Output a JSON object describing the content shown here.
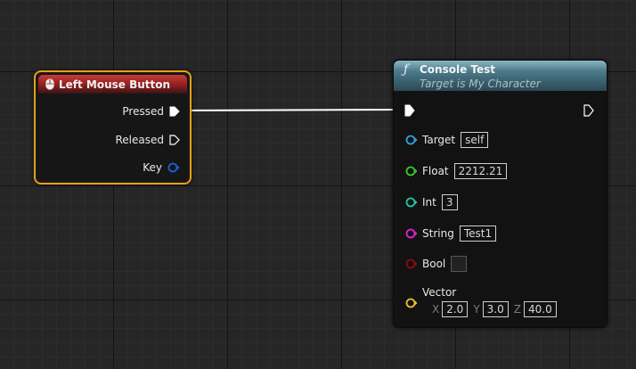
{
  "event_node": {
    "title": "Left Mouse Button",
    "pins": {
      "pressed": "Pressed",
      "released": "Released",
      "key": "Key"
    }
  },
  "function_node": {
    "title": "Console Test",
    "subtitle": "Target is My Character",
    "inputs": [
      {
        "label": "Target",
        "value": "self",
        "color": "#2f9fdd"
      },
      {
        "label": "Float",
        "value": "2212.21",
        "color": "#39c92b"
      },
      {
        "label": "Int",
        "value": "3",
        "color": "#1ec7a3"
      },
      {
        "label": "String",
        "value": "Test1",
        "color": "#e21fd7"
      },
      {
        "label": "Bool",
        "value": "",
        "color": "#8a0b0b"
      },
      {
        "label": "Vector",
        "color": "#f1be28",
        "x": "2.0",
        "y": "3.0",
        "z": "40.0"
      }
    ],
    "axis_labels": {
      "x": "X",
      "y": "Y",
      "z": "Z"
    }
  },
  "colors": {
    "event_border": "#e7a01a",
    "event_header": "#c63a3a",
    "function_header": "#5e8f9e",
    "exec_wire": "#ffffff",
    "key_pin": "#1c5fd6"
  },
  "icons": {
    "function": "ƒ",
    "mouse": "mouse-icon"
  }
}
